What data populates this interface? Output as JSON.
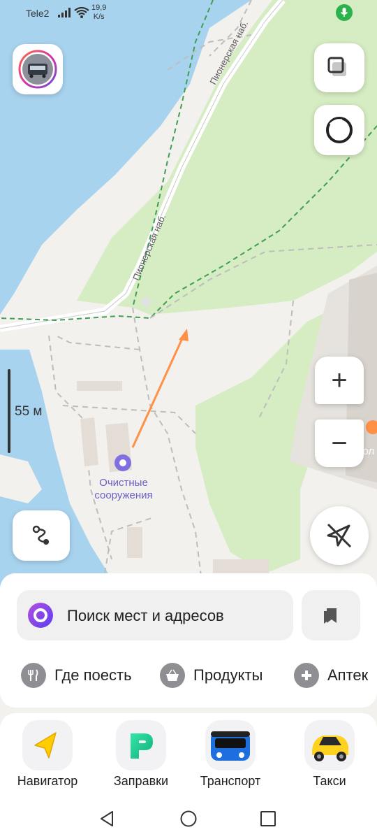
{
  "status_bar": {
    "carrier": "Tele2",
    "speed_value": "19,9",
    "speed_unit": "K/s"
  },
  "map": {
    "street_label_top": "Пионерская наб.",
    "street_label_mid": "Пионерская наб.",
    "poi_name": "Очистные сооружения",
    "poi_partial": "Стол",
    "scale_label": "55 м",
    "colors": {
      "water": "#a8d3ef",
      "park": "#d6ecc2",
      "land": "#f2f1ed",
      "route": "#ff9046",
      "poi": "#7f6fe0"
    }
  },
  "controls": {
    "zoom_in_label": "+",
    "zoom_out_label": "−"
  },
  "sheet": {
    "search_placeholder": "Поиск мест и адресов",
    "categories": [
      {
        "label": "Где поесть",
        "icon": "fork-knife-icon"
      },
      {
        "label": "Продукты",
        "icon": "basket-icon"
      },
      {
        "label": "Аптек",
        "icon": "plus-icon"
      }
    ]
  },
  "dock": {
    "apps": [
      {
        "label": "Навигатор",
        "icon": "navigator-icon"
      },
      {
        "label": "Заправки",
        "icon": "refuel-icon"
      },
      {
        "label": "Транспорт",
        "icon": "bus-icon"
      },
      {
        "label": "Такси",
        "icon": "taxi-icon"
      }
    ]
  }
}
